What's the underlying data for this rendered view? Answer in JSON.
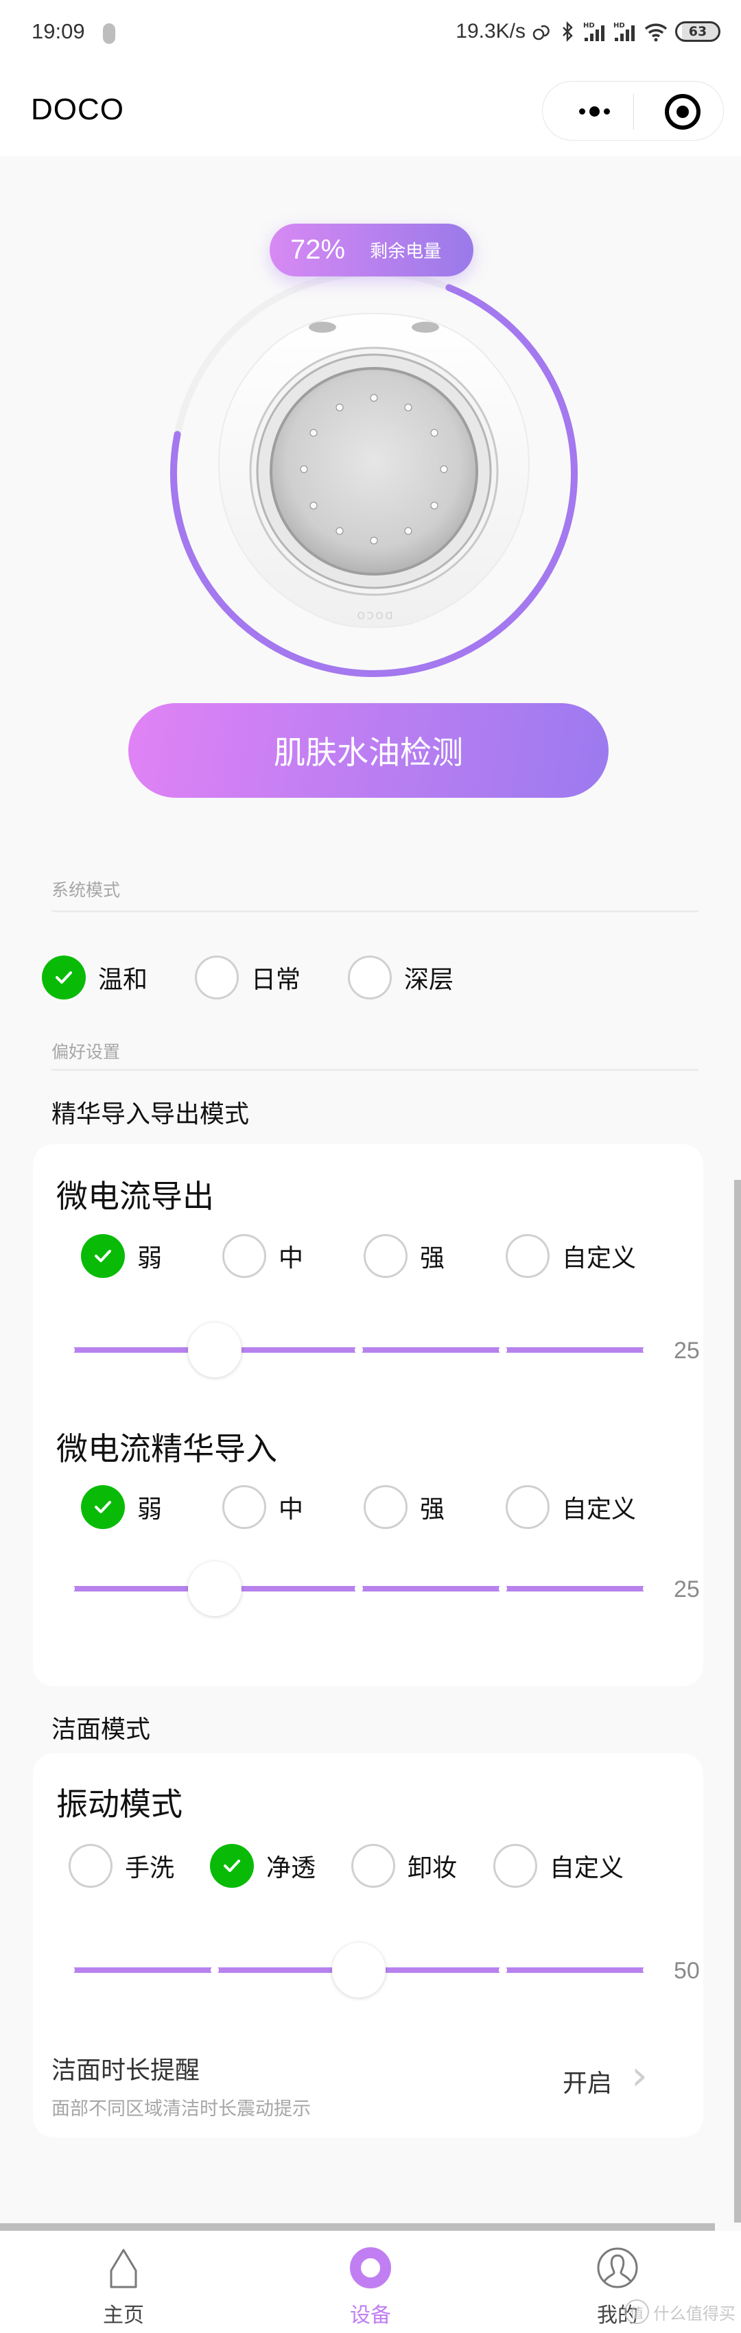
{
  "status_bar": {
    "time": "19:09",
    "network_speed": "19.3K/s",
    "icons": [
      "mic-indicator-icon",
      "link-icon",
      "bluetooth-icon",
      "hd-signal-icon",
      "hd-signal-icon",
      "wifi-icon"
    ],
    "signal_badge": "HD",
    "battery_level": "63"
  },
  "header": {
    "title": "DOCO",
    "more_icon": "more-dots-icon",
    "close_icon": "target-circle-icon"
  },
  "battery": {
    "percent_label": "72%",
    "percent_value": 72,
    "label": "剩余电量",
    "accent_start": "#d789f3",
    "accent_end": "#9a7ae9",
    "device_logo": "DOCO"
  },
  "detect_button": {
    "label": "肌肤水油检测"
  },
  "system_mode": {
    "section_label": "系统模式",
    "options": [
      {
        "label": "温和",
        "checked": true
      },
      {
        "label": "日常",
        "checked": false
      },
      {
        "label": "深层",
        "checked": false
      }
    ]
  },
  "preferences": {
    "section_label": "偏好设置",
    "essence_heading": "精华导入导出模式",
    "output_card": {
      "title": "微电流导出",
      "options": [
        {
          "label": "弱",
          "checked": true
        },
        {
          "label": "中",
          "checked": false
        },
        {
          "label": "强",
          "checked": false
        },
        {
          "label": "自定义",
          "checked": false
        }
      ],
      "slider_value": 25,
      "slider_value_label": "25",
      "slider_max": 100
    },
    "import_card": {
      "title": "微电流精华导入",
      "options": [
        {
          "label": "弱",
          "checked": true
        },
        {
          "label": "中",
          "checked": false
        },
        {
          "label": "强",
          "checked": false
        },
        {
          "label": "自定义",
          "checked": false
        }
      ],
      "slider_value": 25,
      "slider_value_label": "25",
      "slider_max": 100
    },
    "cleansing_heading": "洁面模式",
    "vibration_card": {
      "title": "振动模式",
      "options": [
        {
          "label": "手洗",
          "checked": false
        },
        {
          "label": "净透",
          "checked": true
        },
        {
          "label": "卸妆",
          "checked": false
        },
        {
          "label": "自定义",
          "checked": false
        }
      ],
      "slider_value": 50,
      "slider_value_label": "50",
      "slider_max": 100,
      "reminder": {
        "title": "洁面时长提醒",
        "subtitle": "面部不同区域清洁时长震动提示",
        "state": "开启"
      }
    }
  },
  "tabbar": {
    "items": [
      {
        "label": "主页",
        "icon": "home-icon",
        "active": false
      },
      {
        "label": "设备",
        "icon": "device-icon",
        "active": true
      },
      {
        "label": "我的",
        "icon": "user-icon",
        "active": false
      }
    ],
    "active_color": "#c17ef2"
  },
  "colors": {
    "check_green": "#09bb07",
    "slider_purple": "#b782ee",
    "background": "#f9f9f9"
  },
  "watermark": {
    "badge": "值",
    "text": "什么值得买"
  }
}
